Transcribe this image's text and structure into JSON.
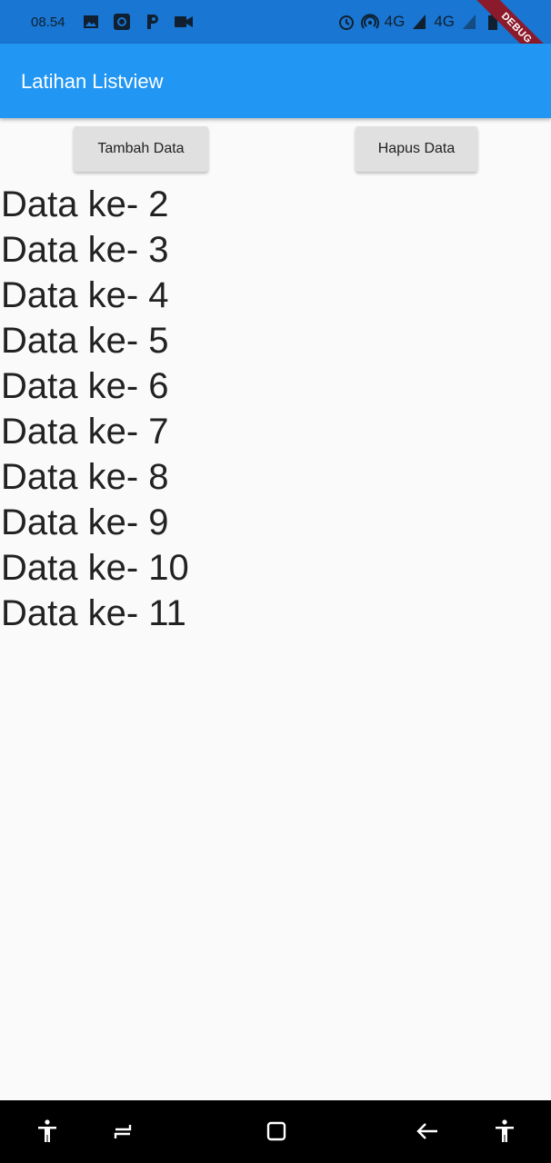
{
  "status_bar": {
    "time": "08.54",
    "net1": "4G",
    "net2": "4G",
    "icons": [
      "image-icon",
      "record-icon",
      "parking-icon",
      "video-icon",
      "alarm-icon",
      "hotspot-icon",
      "signal-icon",
      "signal-icon-2",
      "battery-icon"
    ]
  },
  "debug_ribbon": "DEBUG",
  "app_bar": {
    "title": "Latihan Listview"
  },
  "buttons": {
    "add_label": "Tambah Data",
    "delete_label": "Hapus Data"
  },
  "list": {
    "items": [
      "Data ke- 2",
      "Data ke- 3",
      "Data ke- 4",
      "Data ke- 5",
      "Data ke- 6",
      "Data ke- 7",
      "Data ke- 8",
      "Data ke- 9",
      "Data ke- 10",
      "Data ke- 11"
    ]
  },
  "nav_bar": {
    "icons": [
      "accessibility-icon",
      "recents-icon",
      "home-icon",
      "back-icon",
      "accessibility-icon-2"
    ]
  },
  "colors": {
    "primary": "#2196f3",
    "status_bar": "#1976d2",
    "background": "#fafafa",
    "button": "#e0e0e0"
  }
}
